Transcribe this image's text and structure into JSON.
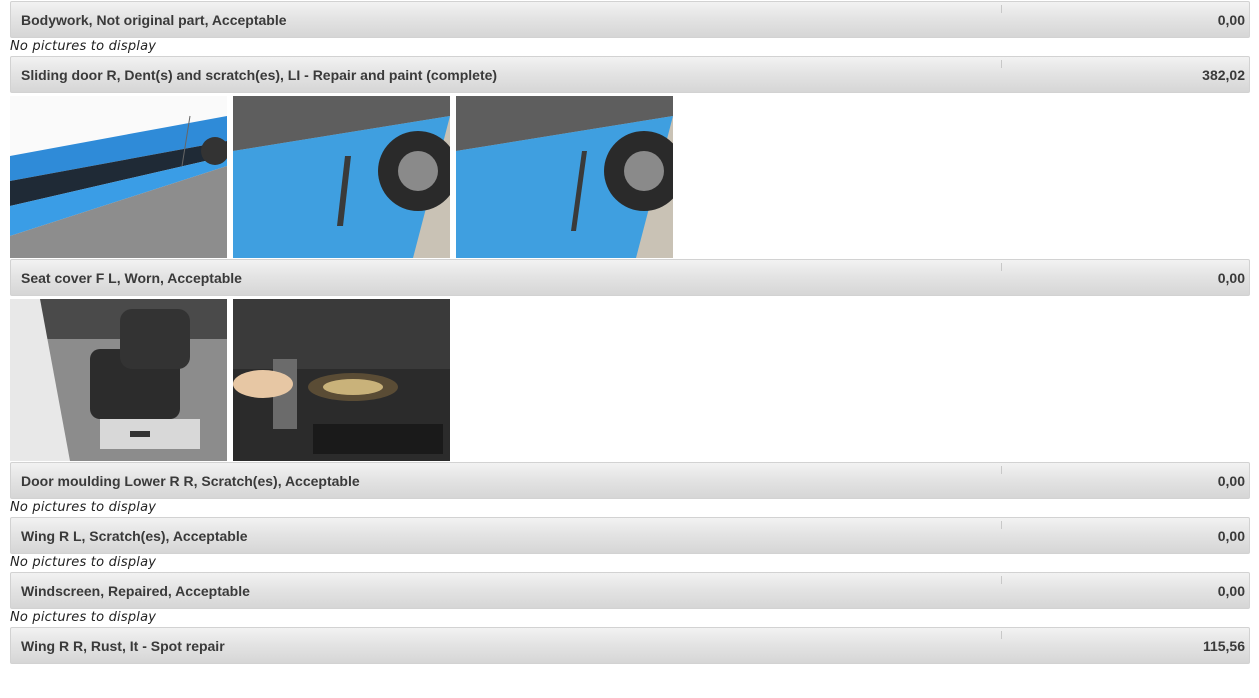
{
  "no_pictures_text": "No pictures to display",
  "items": [
    {
      "description": "Bodywork, Not original part, Acceptable",
      "amount": "0,00"
    },
    {
      "description": "Sliding door R, Dent(s) and scratch(es), LI - Repair and paint (complete)",
      "amount": "382,02"
    },
    {
      "description": "Seat cover F L, Worn, Acceptable",
      "amount": "0,00"
    },
    {
      "description": "Door moulding Lower R R, Scratch(es), Acceptable",
      "amount": "0,00"
    },
    {
      "description": "Wing R L, Scratch(es), Acceptable",
      "amount": "0,00"
    },
    {
      "description": "Windscreen, Repaired, Acceptable",
      "amount": "0,00"
    },
    {
      "description": "Wing R R, Rust, It - Spot repair",
      "amount": "115,56"
    }
  ],
  "photos": {
    "sliding_door": [
      "van-side-photo",
      "door-dent-closeup-photo",
      "door-dent-closeup-photo-2"
    ],
    "seat_cover": [
      "driver-seat-photo",
      "seat-wear-closeup-photo"
    ]
  }
}
